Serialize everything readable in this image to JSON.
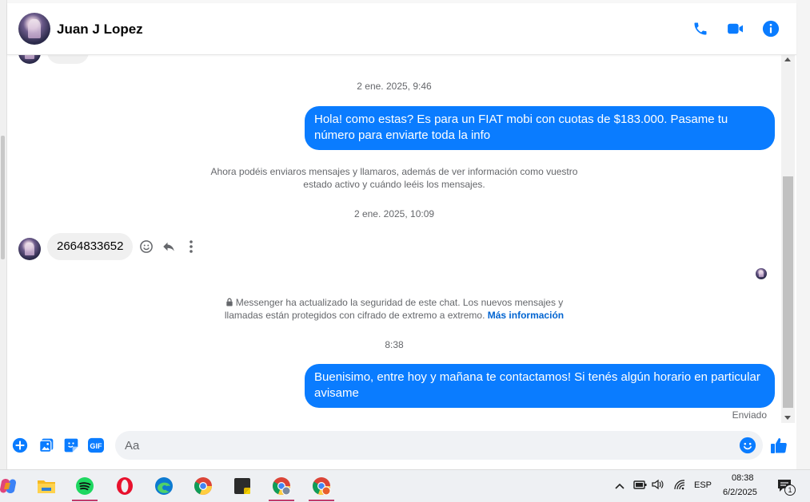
{
  "contact": {
    "name": "Juan J Lopez"
  },
  "colors": {
    "accent": "#0a7cff",
    "bubble_in": "#f0f0f0",
    "meta": "#65676b",
    "link": "#0064d1"
  },
  "header_icons": [
    "phone-icon",
    "video-icon",
    "info-icon"
  ],
  "messages": {
    "partial_in": "info",
    "ts1": "2 ene. 2025, 9:46",
    "out1": "Hola! como estas? Es para un FIAT mobi con cuotas de $183.000. Pasame tu número para enviarte toda la info",
    "sys1": "Ahora podéis enviaros mensajes y llamaros, además de ver información como vuestro estado activo y cuándo leéis los mensajes.",
    "ts2": "2 ene. 2025, 10:09",
    "in1": "2664833652",
    "sys2": "Messenger ha actualizado la seguridad de este chat. Los nuevos mensajes y llamadas están protegidos con cifrado de extremo a extremo.",
    "sys2_link": "Más información",
    "ts3": "8:38",
    "out2": "Buenisimo, entre hoy y mañana te contactamos! Si tenés algún horario en particular avisame",
    "status": "Enviado"
  },
  "composer": {
    "placeholder": "Aa"
  },
  "taskbar": {
    "apps": [
      "copilot-icon",
      "file-explorer-icon",
      "spotify-icon",
      "opera-icon",
      "edge-icon",
      "chrome-icon",
      "sticky-notes-icon",
      "chrome-profile-icon",
      "chrome-profile-2-icon"
    ],
    "language": "ESP",
    "time": "08:38",
    "date": "6/2/2025",
    "notifications": "1"
  }
}
